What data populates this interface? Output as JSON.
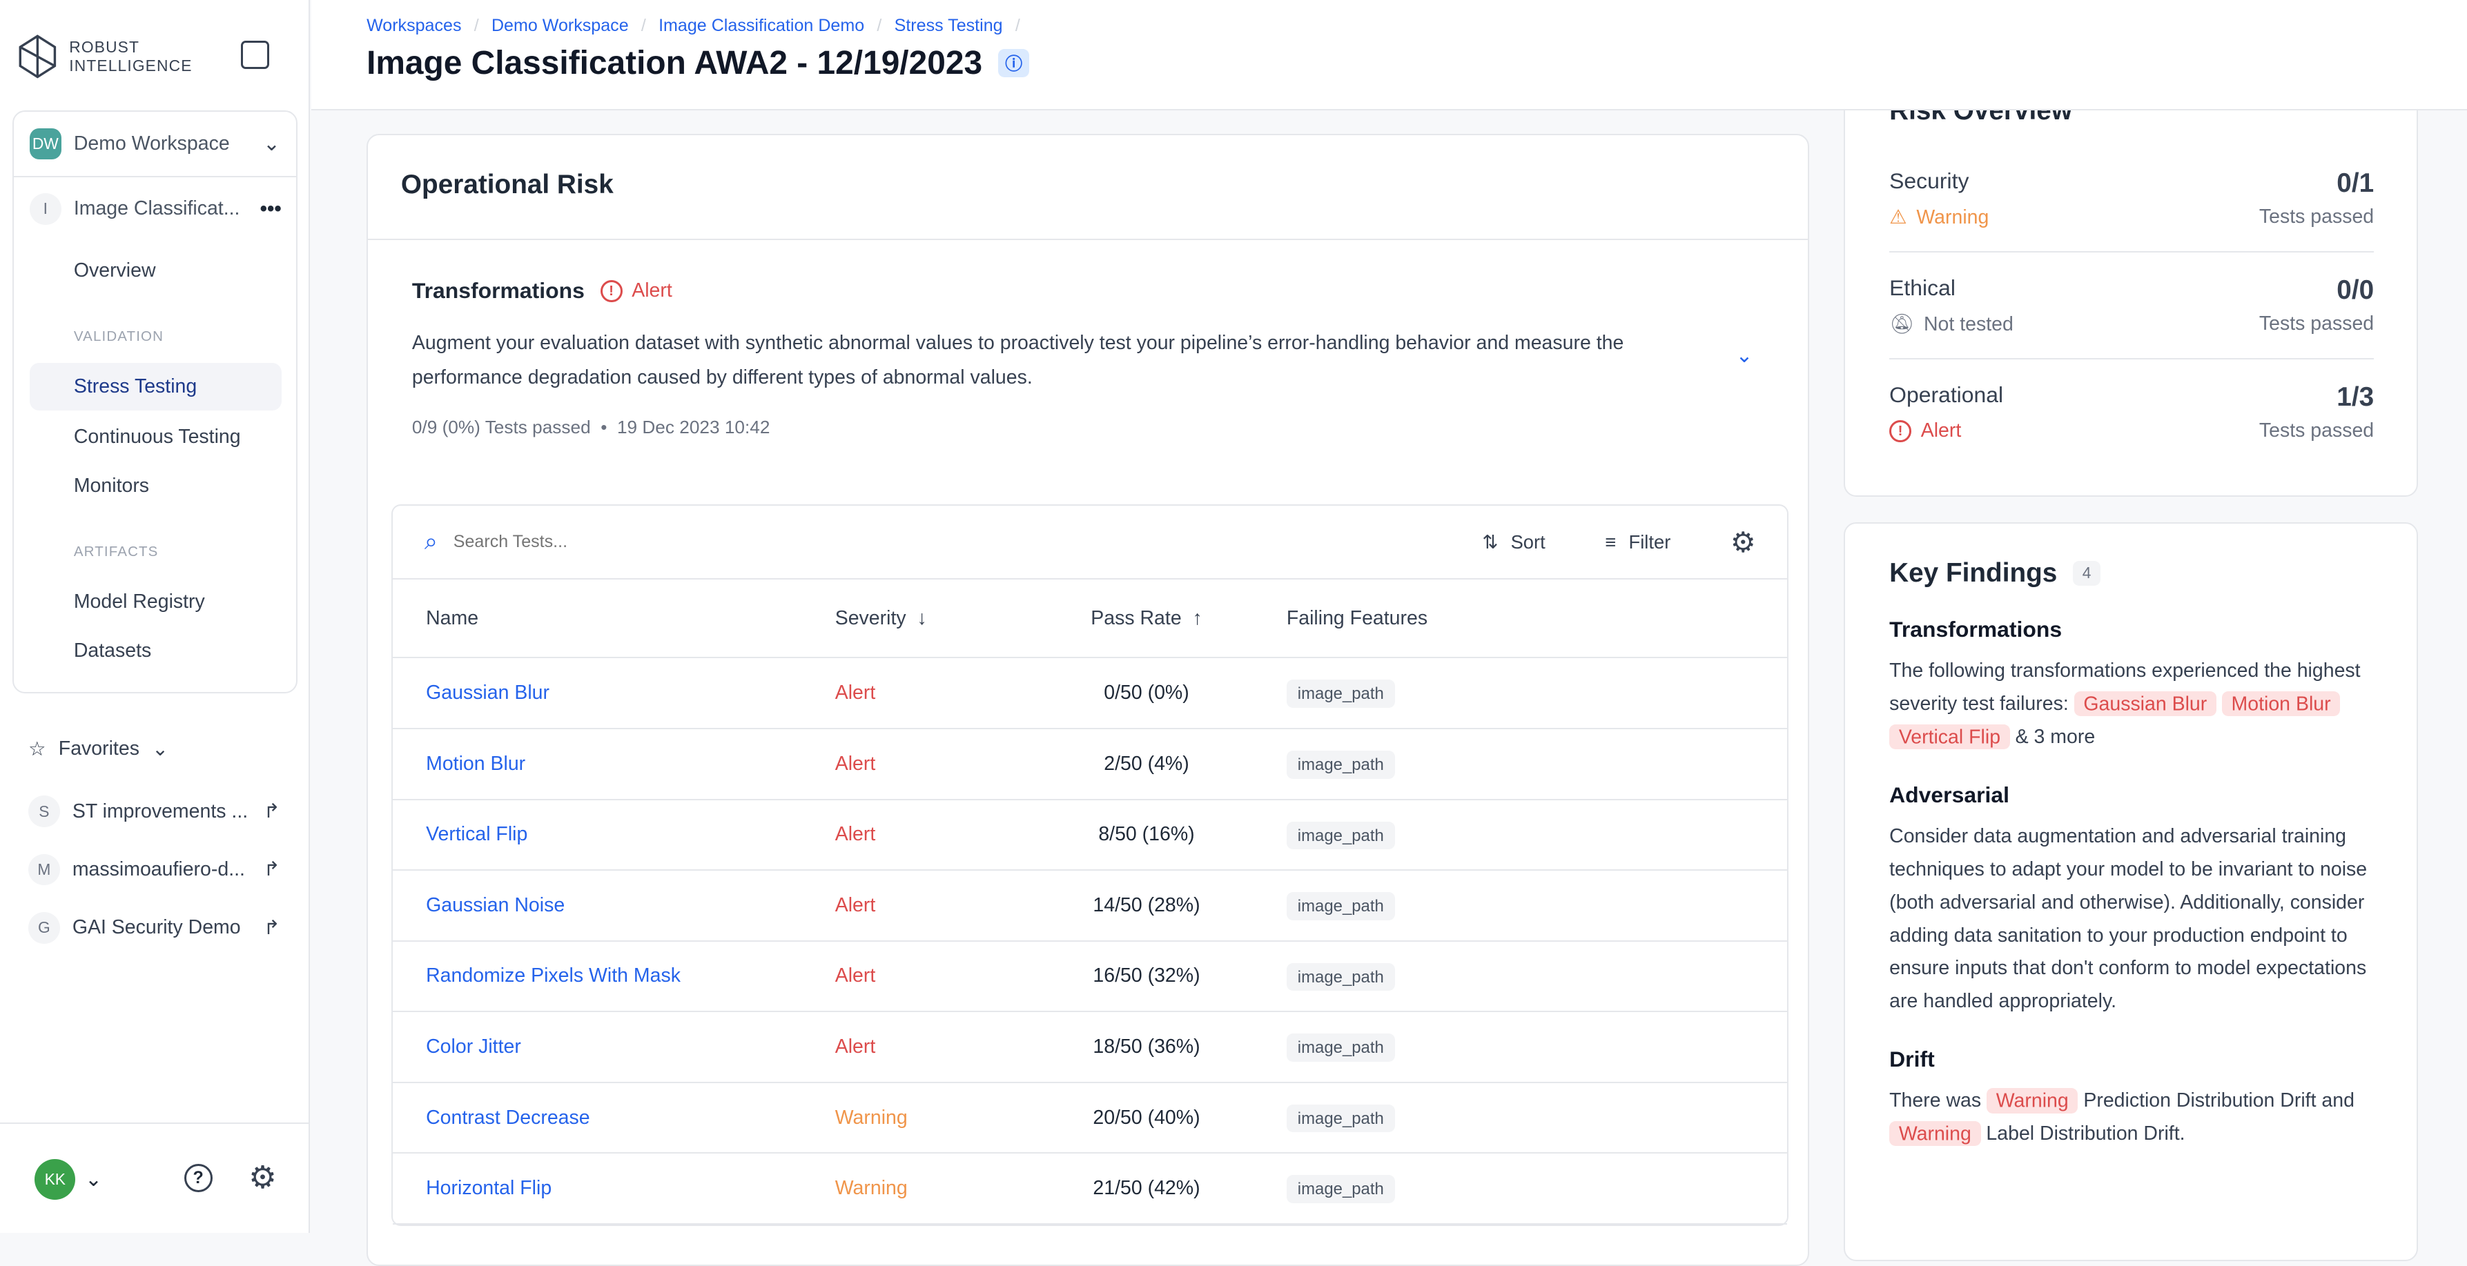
{
  "brand": {
    "line1": "ROBUST",
    "line2": "INTELLIGENCE"
  },
  "sidebar": {
    "workspace": {
      "initials": "DW",
      "name": "Demo Workspace"
    },
    "project": {
      "initial": "I",
      "name": "Image Classificat..."
    },
    "overview": "Overview",
    "validation_label": "VALIDATION",
    "validation_items": [
      "Stress Testing",
      "Continuous Testing",
      "Monitors"
    ],
    "artifacts_label": "ARTIFACTS",
    "artifacts_items": [
      "Model Registry",
      "Datasets"
    ],
    "favorites_label": "Favorites",
    "favorites": [
      {
        "initial": "S",
        "name": "ST improvements ..."
      },
      {
        "initial": "M",
        "name": "massimoaufiero-d..."
      },
      {
        "initial": "G",
        "name": "GAI Security Demo"
      }
    ],
    "user_initials": "KK"
  },
  "header": {
    "breadcrumbs": [
      "Workspaces",
      "Demo Workspace",
      "Image Classification Demo",
      "Stress Testing"
    ],
    "title": "Image Classification AWA2 - 12/19/2023"
  },
  "operational": {
    "title": "Operational Risk",
    "section": "Transformations",
    "status": "Alert",
    "description": "Augment your evaluation dataset with synthetic abnormal values to proactively test your pipeline’s error-handling behavior and measure the performance degradation caused by different types of abnormal values.",
    "summary": "0/9 (0%) Tests passed",
    "date": "19 Dec 2023 10:42",
    "search_placeholder": "Search Tests...",
    "sort": "Sort",
    "filter": "Filter",
    "columns": [
      "Name",
      "Severity",
      "Pass Rate",
      "Failing Features"
    ],
    "rows": [
      {
        "name": "Gaussian Blur",
        "severity": "Alert",
        "rate": "0/50 (0%)",
        "feature": "image_path"
      },
      {
        "name": "Motion Blur",
        "severity": "Alert",
        "rate": "2/50 (4%)",
        "feature": "image_path"
      },
      {
        "name": "Vertical Flip",
        "severity": "Alert",
        "rate": "8/50 (16%)",
        "feature": "image_path"
      },
      {
        "name": "Gaussian Noise",
        "severity": "Alert",
        "rate": "14/50 (28%)",
        "feature": "image_path"
      },
      {
        "name": "Randomize Pixels With Mask",
        "severity": "Alert",
        "rate": "16/50 (32%)",
        "feature": "image_path"
      },
      {
        "name": "Color Jitter",
        "severity": "Alert",
        "rate": "18/50 (36%)",
        "feature": "image_path"
      },
      {
        "name": "Contrast Decrease",
        "severity": "Warning",
        "rate": "20/50 (40%)",
        "feature": "image_path"
      },
      {
        "name": "Horizontal Flip",
        "severity": "Warning",
        "rate": "21/50 (42%)",
        "feature": "image_path"
      }
    ]
  },
  "risk_overview": {
    "title": "Risk Overview",
    "rows": [
      {
        "name": "Security",
        "status": "Warning",
        "score": "0/1",
        "label": "Tests passed"
      },
      {
        "name": "Ethical",
        "status": "Not tested",
        "score": "0/0",
        "label": "Tests passed"
      },
      {
        "name": "Operational",
        "status": "Alert",
        "score": "1/3",
        "label": "Tests passed"
      }
    ]
  },
  "key_findings": {
    "title": "Key Findings",
    "count": "4",
    "transformations": {
      "title": "Transformations",
      "text": "The following transformations experienced the highest severity test failures:",
      "tags": [
        "Gaussian Blur",
        "Motion Blur",
        "Vertical Flip"
      ],
      "more": "& 3 more"
    },
    "adversarial": {
      "title": "Adversarial",
      "text": "Consider data augmentation and adversarial training techniques to adapt your model to be invariant to noise (both adversarial and otherwise). Additionally, consider adding data sanitation to your production endpoint to ensure inputs that don't conform to model expectations are handled appropriately."
    },
    "drift": {
      "title": "Drift",
      "pre": "There was",
      "tag": "Warning",
      "mid": "Prediction Distribution Drift and",
      "post": "Label Distribution Drift."
    }
  },
  "colors": {
    "alert": "#dc4c4c",
    "warning": "#f0954a",
    "link": "#2563eb",
    "workspace_avatar": "#4aa39c",
    "user_avatar": "#3aa14a"
  }
}
